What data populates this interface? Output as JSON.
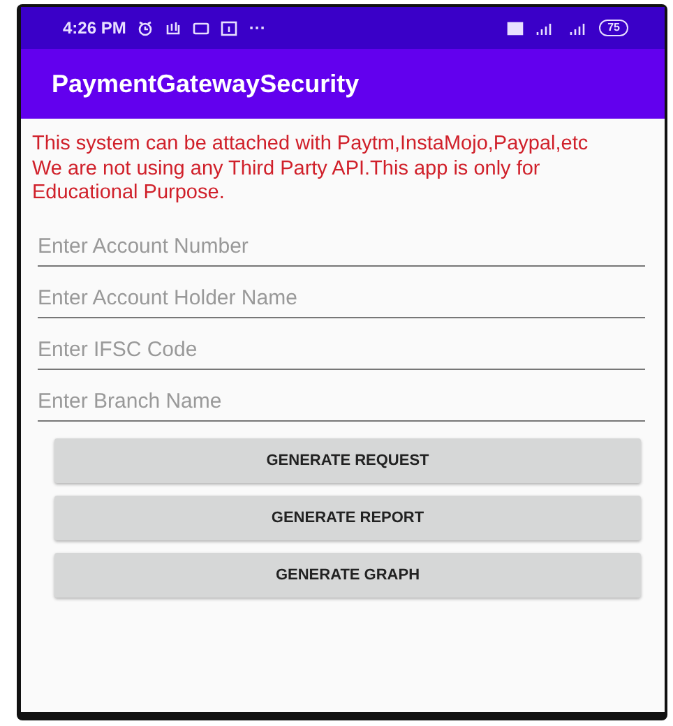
{
  "status_bar": {
    "time": "4:26 PM",
    "overflow": "···",
    "battery": "75"
  },
  "app_bar": {
    "title": "PaymentGatewaySecurity"
  },
  "notices": [
    "This system can be attached with Paytm,InstaMojo,Paypal,etc",
    "We are not using any Third Party API.This app is only for Educational Purpose."
  ],
  "fields": [
    {
      "placeholder": "Enter Account Number"
    },
    {
      "placeholder": "Enter Account Holder Name"
    },
    {
      "placeholder": "Enter IFSC Code"
    },
    {
      "placeholder": "Enter Branch Name"
    }
  ],
  "buttons": [
    "GENERATE REQUEST",
    "GENERATE REPORT",
    "GENERATE GRAPH"
  ]
}
